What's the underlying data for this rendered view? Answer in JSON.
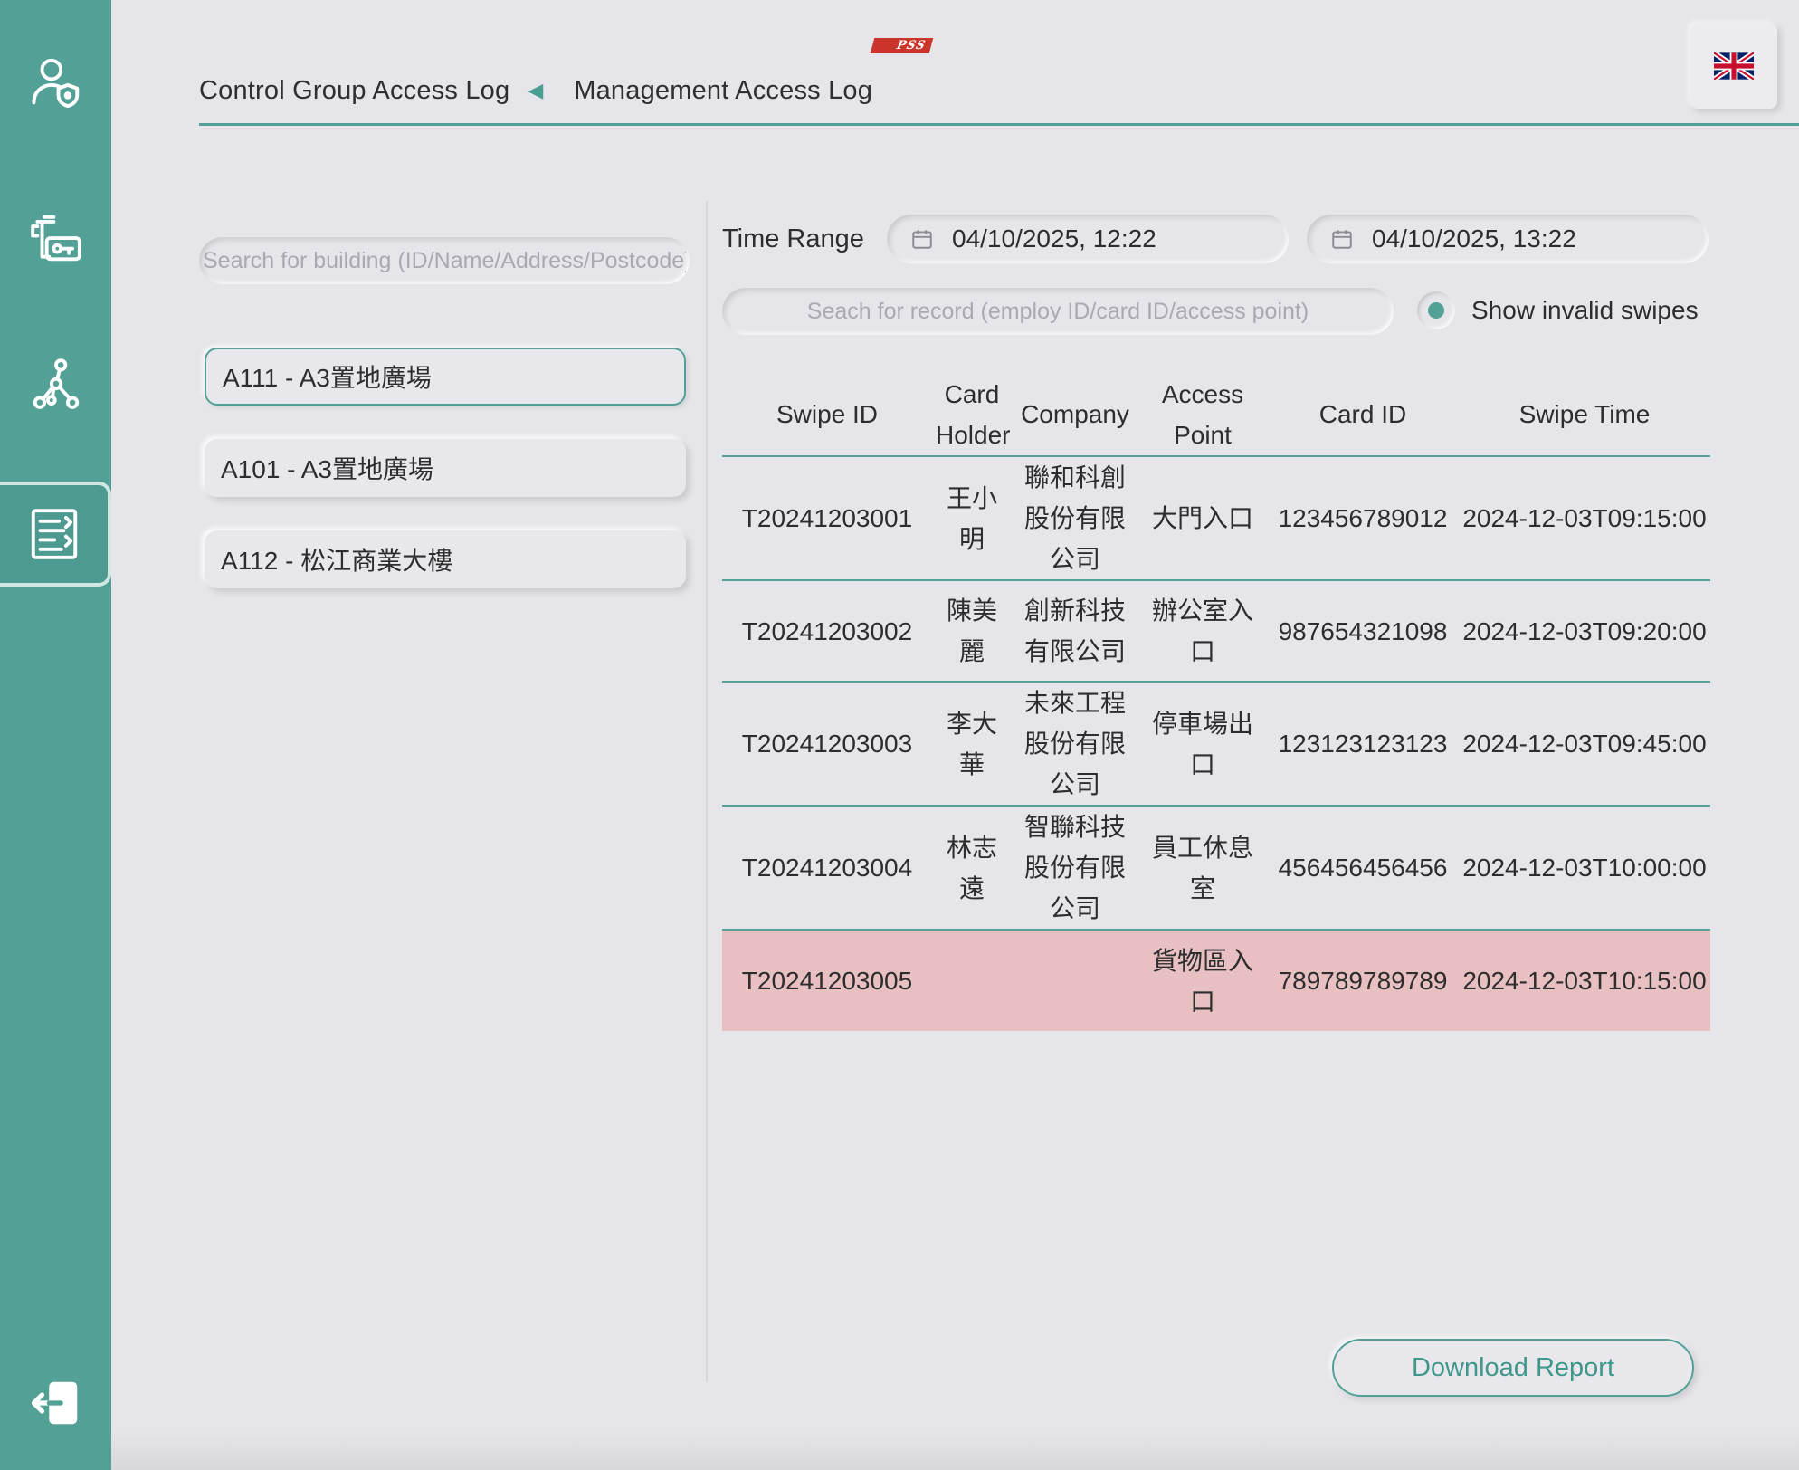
{
  "sidebar": {
    "items": [
      {
        "icon": "user-shield-icon"
      },
      {
        "icon": "key-card-icon"
      },
      {
        "icon": "network-nodes-icon"
      },
      {
        "icon": "report-list-icon",
        "active": true
      }
    ],
    "logout_icon": "logout-icon"
  },
  "header": {
    "tabs": [
      {
        "label": "Control Group Access Log"
      },
      {
        "label": "Management Access Log"
      }
    ],
    "tab_arrow": "◀",
    "logo": {
      "stripes": "///",
      "text": "PSS"
    },
    "language_icon": "uk-flag-icon"
  },
  "buildings": {
    "search_placeholder": "Search for building (ID/Name/Address/Postcode)",
    "items": [
      {
        "label": "A111 - A3置地廣場",
        "selected": true
      },
      {
        "label": "A101 - A3置地廣場",
        "selected": false
      },
      {
        "label": "A112 - 松江商業大樓",
        "selected": false
      }
    ]
  },
  "filters": {
    "time_range_label": "Time Range",
    "from": "04/10/2025, 12:22",
    "to": "04/10/2025, 13:22",
    "record_search_placeholder": "Seach for record (employ ID/card ID/access point)",
    "show_invalid_label": "Show invalid swipes",
    "show_invalid_checked": true
  },
  "table": {
    "headers": [
      "Swipe ID",
      "Card Holder",
      "Company",
      "Access Point",
      "Card ID",
      "Swipe Time"
    ],
    "rows": [
      {
        "swipe_id": "T20241203001",
        "holder": "王小明",
        "company": "聯和科創股份有限公司",
        "access": "大門入口",
        "card_id": "123456789012",
        "time": "2024-12-03T09:15:00",
        "invalid": false
      },
      {
        "swipe_id": "T20241203002",
        "holder": "陳美麗",
        "company": "創新科技有限公司",
        "access": "辦公室入口",
        "card_id": "987654321098",
        "time": "2024-12-03T09:20:00",
        "invalid": false
      },
      {
        "swipe_id": "T20241203003",
        "holder": "李大華",
        "company": "未來工程股份有限公司",
        "access": "停車場出口",
        "card_id": "123123123123",
        "time": "2024-12-03T09:45:00",
        "invalid": false
      },
      {
        "swipe_id": "T20241203004",
        "holder": "林志遠",
        "company": "智聯科技股份有限公司",
        "access": "員工休息室",
        "card_id": "456456456456",
        "time": "2024-12-03T10:00:00",
        "invalid": false
      },
      {
        "swipe_id": "T20241203005",
        "holder": "",
        "company": "",
        "access": "貨物區入口",
        "card_id": "789789789789",
        "time": "2024-12-03T10:15:00",
        "invalid": true
      }
    ]
  },
  "actions": {
    "download_label": "Download Report"
  },
  "colors": {
    "accent": "#52a096",
    "invalid_row": "#e8c0c2",
    "background": "#e6e6ea"
  }
}
